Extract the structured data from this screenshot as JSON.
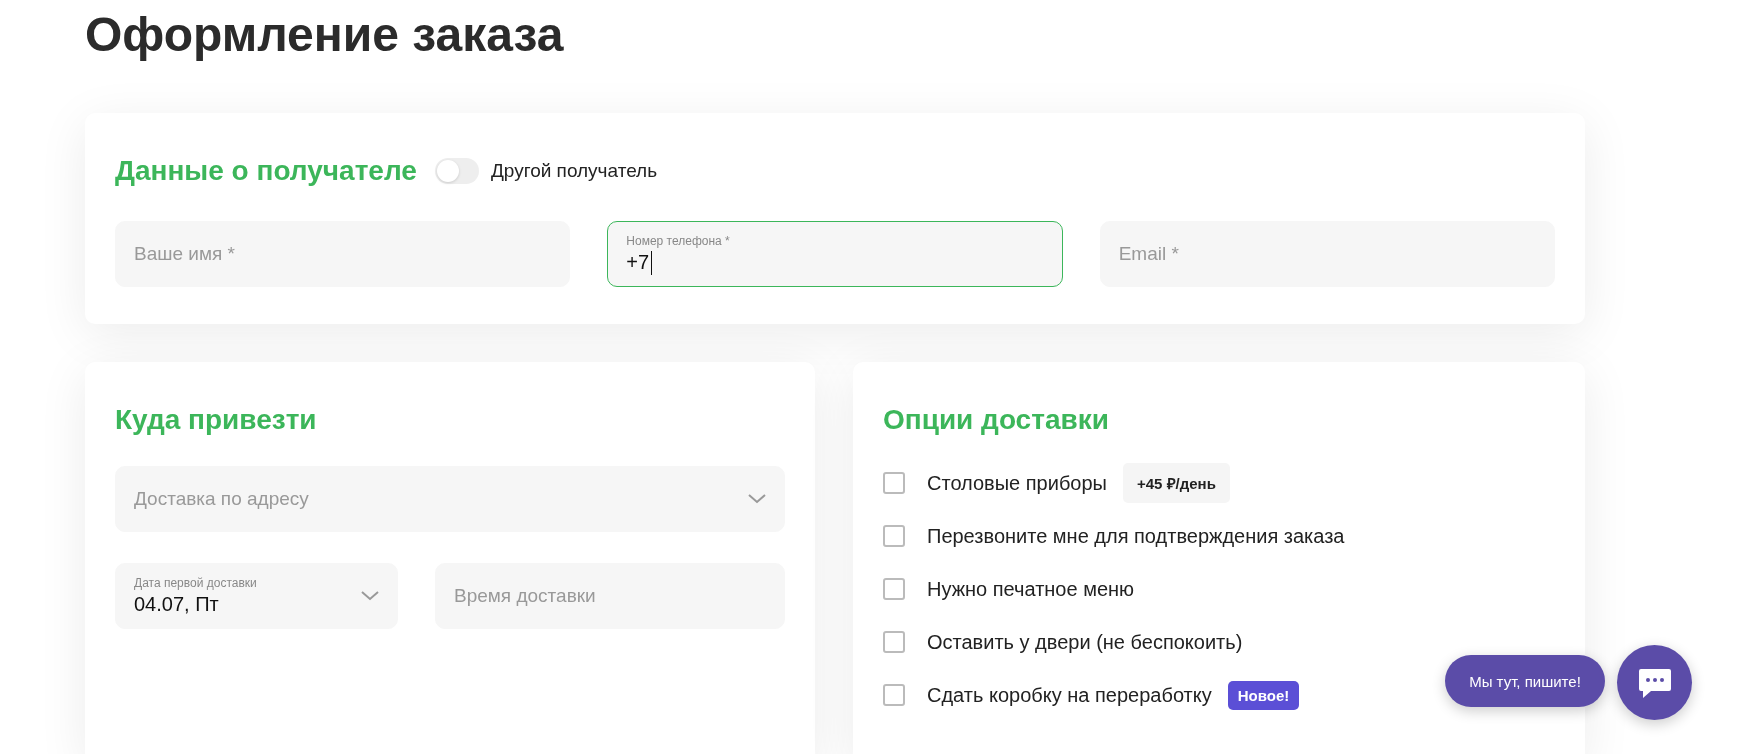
{
  "page_title": "Оформление заказа",
  "recipient": {
    "title": "Данные о получателе",
    "toggle": {
      "label": "Другой получатель",
      "on": false
    },
    "fields": [
      {
        "kind": "empty",
        "placeholder": "Ваше имя *",
        "focused": false
      },
      {
        "kind": "filled",
        "label": "Номер телефона *",
        "value": "+7",
        "focused": true
      },
      {
        "kind": "empty",
        "placeholder": "Email *",
        "focused": false
      }
    ]
  },
  "delivery": {
    "title": "Куда привезти",
    "method": {
      "placeholder": "Доставка по адресу"
    },
    "date": {
      "label": "Дата первой доставки",
      "value": "04.07, Пт"
    },
    "time": {
      "placeholder": "Время доставки"
    }
  },
  "options": {
    "title": "Опции доставки",
    "items": [
      {
        "label": "Столовые приборы",
        "checked": false,
        "badge": {
          "kind": "price",
          "text": "+45 ₽/день"
        }
      },
      {
        "label": "Перезвоните мне для подтверждения заказа",
        "checked": false
      },
      {
        "label": "Нужно печатное меню",
        "checked": false
      },
      {
        "label": "Оставить у двери (не беспокоить)",
        "checked": false
      },
      {
        "label": "Сдать коробку на переработку",
        "checked": false,
        "badge": {
          "kind": "new",
          "text": "Новое!"
        }
      }
    ]
  },
  "chat": {
    "bubble": "Мы тут, пишите!"
  }
}
